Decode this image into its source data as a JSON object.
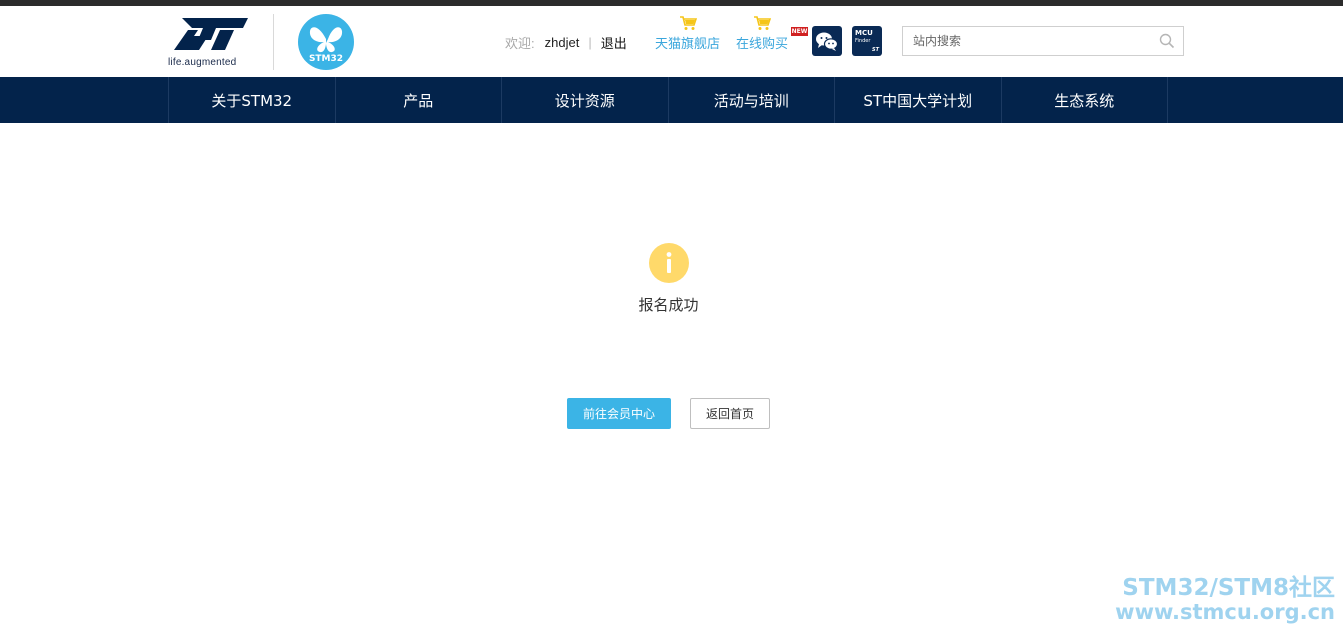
{
  "header": {
    "tagline": "life.augmented",
    "stm32_logo_text": "STM32",
    "welcome_label": "欢迎:",
    "username": "zhdjet",
    "separator": "|",
    "logout_label": "退出",
    "shop_tmall_label": "天猫旗舰店",
    "shop_online_label": "在线购买",
    "new_badge": "NEW",
    "mcu_finder": {
      "line1": "MCU",
      "line2": "Finder",
      "line3": "ST"
    },
    "search_placeholder": "站内搜索"
  },
  "nav": {
    "items": [
      {
        "label": "关于STM32"
      },
      {
        "label": "产品"
      },
      {
        "label": "设计资源"
      },
      {
        "label": "活动与培训"
      },
      {
        "label": "ST中国大学计划"
      },
      {
        "label": "生态系统"
      }
    ]
  },
  "main": {
    "message": "报名成功",
    "primary_button": "前往会员中心",
    "secondary_button": "返回首页"
  },
  "watermark": {
    "line1": "STM32/STM8社区",
    "line2": "www.stmcu.org.cn"
  },
  "colors": {
    "nav_bg": "#03234b",
    "accent": "#3bb4e6",
    "link": "#3aa6dc",
    "info_icon": "#ffd96a",
    "cart_icon": "#f5c518"
  },
  "icons": {
    "info": "info-icon",
    "cart": "shopping-cart-icon",
    "wechat": "wechat-icon",
    "search": "search-icon"
  }
}
